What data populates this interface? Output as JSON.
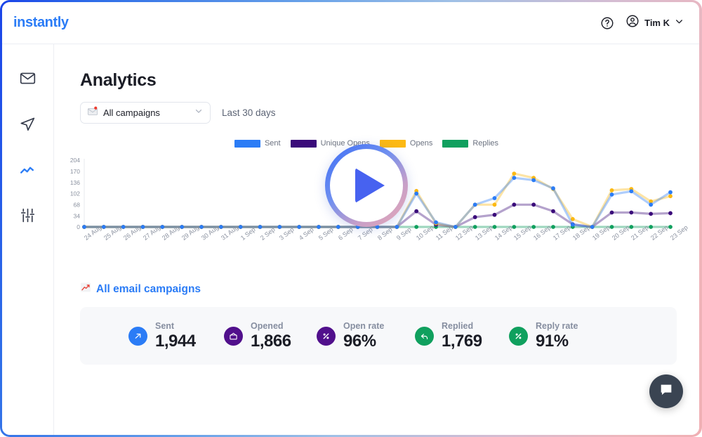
{
  "header": {
    "logo": "instantly",
    "help_icon": "question-circle-icon",
    "user_icon": "user-circle-icon",
    "user_name": "Tim K",
    "chevron_icon": "chevron-down-icon"
  },
  "sidebar": {
    "items": [
      {
        "name": "inbox",
        "icon": "envelope-icon",
        "active": false
      },
      {
        "name": "campaigns",
        "icon": "paper-plane-icon",
        "active": false
      },
      {
        "name": "analytics",
        "icon": "line-chart-icon",
        "active": true
      },
      {
        "name": "settings",
        "icon": "sliders-icon",
        "active": false
      }
    ],
    "active_color": "#2b7cf6",
    "idle_color": "#353b4b"
  },
  "main": {
    "title": "Analytics",
    "campaign_select": {
      "icon": "envelope-red-dot-icon",
      "value": "All campaigns",
      "chevron": "chevron-down-icon"
    },
    "date_range": "Last 30 days",
    "campaigns_link": {
      "icon": "chart-increasing-icon",
      "label": "All email campaigns"
    },
    "play_overlay": {
      "icon": "play-triangle-icon",
      "color": "#4762f0"
    },
    "chat_button": {
      "icon": "chat-bubble-icon",
      "color": "#3a4452"
    }
  },
  "stats": [
    {
      "label": "Sent",
      "value": "1,944",
      "icon": "send-arrow-icon",
      "color": "#2b7cf6"
    },
    {
      "label": "Opened",
      "value": "1,866",
      "icon": "open-mail-icon",
      "color": "#51108c"
    },
    {
      "label": "Open rate",
      "value": "96%",
      "icon": "percent-icon",
      "color": "#51108c"
    },
    {
      "label": "Replied",
      "value": "1,769",
      "icon": "reply-arrow-icon",
      "color": "#10a05e"
    },
    {
      "label": "Reply rate",
      "value": "91%",
      "icon": "percent-icon",
      "color": "#10a05e"
    }
  ],
  "chart_data": {
    "type": "line",
    "title": "",
    "xlabel": "",
    "ylabel": "",
    "grid": false,
    "legend_position": "top-center",
    "ylim": [
      0,
      204
    ],
    "yticks": [
      0,
      34,
      68,
      102,
      136,
      170,
      204
    ],
    "categories": [
      "24 Aug",
      "25 Aug",
      "26 Aug",
      "27 Aug",
      "28 Aug",
      "29 Aug",
      "30 Aug",
      "31 Aug",
      "1 Sep",
      "2 Sep",
      "3 Sep",
      "4 Sep",
      "5 Sep",
      "6 Sep",
      "7 Sep",
      "8 Sep",
      "9 Sep",
      "10 Sep",
      "11 Sep",
      "12 Sep",
      "13 Sep",
      "14 Sep",
      "15 Sep",
      "16 Sep",
      "17 Sep",
      "18 Sep",
      "19 Sep",
      "20 Sep",
      "21 Sep",
      "22 Sep",
      "23 Sep"
    ],
    "series": [
      {
        "name": "Sent",
        "color": "#2b7cf6",
        "values": [
          0,
          0,
          0,
          0,
          0,
          0,
          0,
          0,
          0,
          0,
          0,
          0,
          0,
          0,
          0,
          0,
          0,
          102,
          14,
          0,
          68,
          88,
          150,
          143,
          118,
          7,
          0,
          99,
          109,
          68,
          106
        ]
      },
      {
        "name": "Unique Opens",
        "color": "#3a0a7a",
        "values": [
          0,
          0,
          0,
          0,
          0,
          0,
          0,
          0,
          0,
          0,
          0,
          0,
          0,
          0,
          0,
          0,
          0,
          48,
          7,
          0,
          30,
          37,
          68,
          68,
          48,
          8,
          0,
          44,
          44,
          40,
          42
        ]
      },
      {
        "name": "Opens",
        "color": "#fcb913",
        "values": [
          0,
          0,
          0,
          0,
          0,
          0,
          0,
          0,
          0,
          0,
          0,
          0,
          0,
          0,
          0,
          0,
          0,
          110,
          11,
          0,
          68,
          68,
          163,
          150,
          116,
          24,
          0,
          112,
          116,
          78,
          94
        ]
      },
      {
        "name": "Replies",
        "color": "#10a05e",
        "values": [
          0,
          0,
          0,
          0,
          0,
          0,
          0,
          0,
          0,
          0,
          0,
          0,
          0,
          0,
          0,
          0,
          0,
          0,
          0,
          0,
          0,
          0,
          0,
          0,
          0,
          0,
          0,
          0,
          0,
          0,
          0
        ]
      }
    ]
  }
}
